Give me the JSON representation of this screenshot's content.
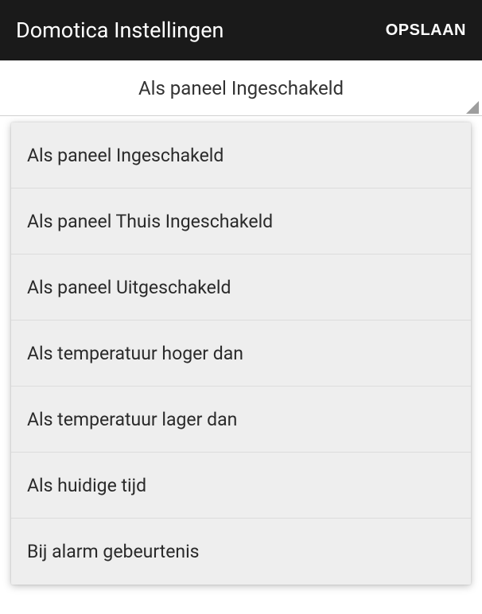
{
  "header": {
    "title": "Domotica Instellingen",
    "save_label": "OPSLAAN"
  },
  "selected": {
    "label": "Als paneel Ingeschakeld"
  },
  "dropdown": {
    "items": [
      {
        "label": "Als paneel Ingeschakeld"
      },
      {
        "label": "Als paneel Thuis Ingeschakeld"
      },
      {
        "label": "Als paneel Uitgeschakeld"
      },
      {
        "label": "Als temperatuur hoger dan"
      },
      {
        "label": "Als temperatuur lager dan"
      },
      {
        "label": "Als huidige tijd"
      },
      {
        "label": "Bij alarm gebeurtenis"
      }
    ]
  }
}
